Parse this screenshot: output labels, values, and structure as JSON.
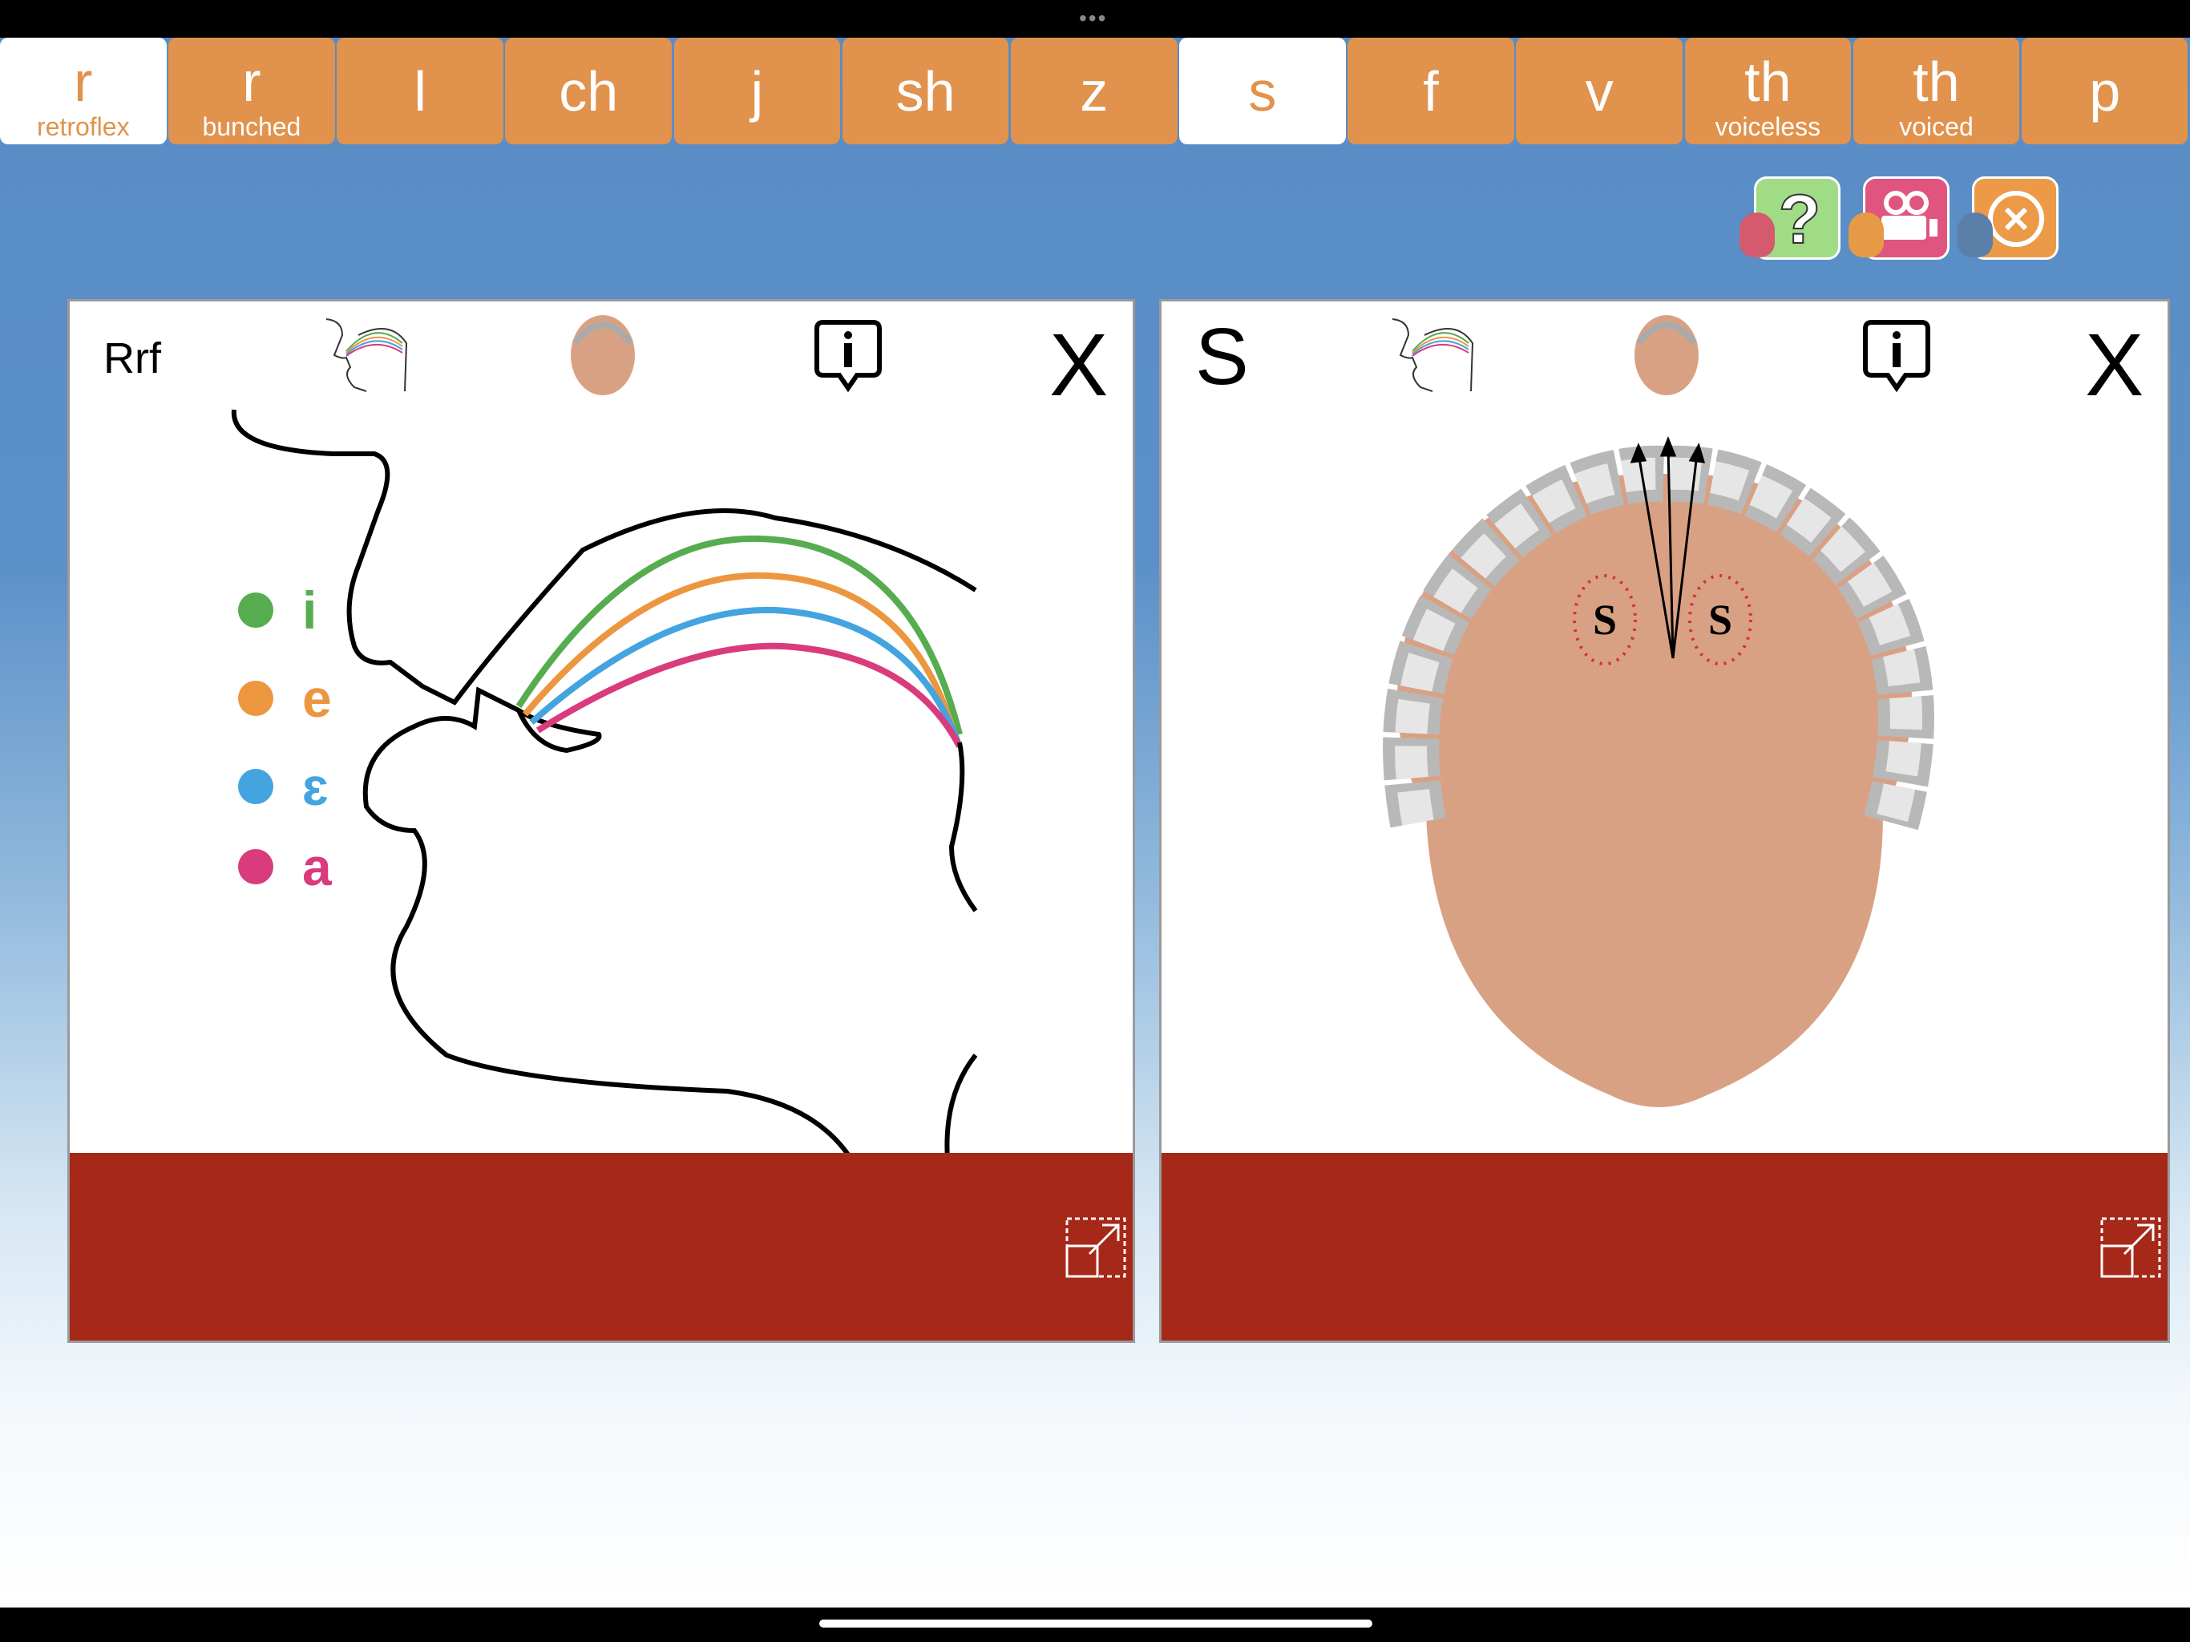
{
  "tabs": [
    {
      "label": "r",
      "sublabel": "retroflex",
      "active": true
    },
    {
      "label": "r",
      "sublabel": "bunched",
      "active": false
    },
    {
      "label": "l",
      "sublabel": "",
      "active": false
    },
    {
      "label": "ch",
      "sublabel": "",
      "active": false
    },
    {
      "label": "j",
      "sublabel": "",
      "active": false
    },
    {
      "label": "sh",
      "sublabel": "",
      "active": false
    },
    {
      "label": "z",
      "sublabel": "",
      "active": false
    },
    {
      "label": "s",
      "sublabel": "",
      "active": true
    },
    {
      "label": "f",
      "sublabel": "",
      "active": false
    },
    {
      "label": "v",
      "sublabel": "",
      "active": false
    },
    {
      "label": "th",
      "sublabel": "voiceless",
      "active": false
    },
    {
      "label": "th",
      "sublabel": "voiced",
      "active": false
    },
    {
      "label": "p",
      "sublabel": "",
      "active": false
    }
  ],
  "actions": [
    {
      "name": "help",
      "icon": "question-icon",
      "color": "#a0dc86"
    },
    {
      "name": "video",
      "icon": "video-camera-icon",
      "color": "#e0557f"
    },
    {
      "name": "close",
      "icon": "close-circle-icon",
      "color": "#ec9a48"
    }
  ],
  "left_panel": {
    "label": "Rrf",
    "close": "X",
    "legend": [
      {
        "label": "i",
        "color": "#57ac50"
      },
      {
        "label": "e",
        "color": "#ec9640"
      },
      {
        "label": "ɛ",
        "color": "#44a4e0"
      },
      {
        "label": "a",
        "color": "#d93b7d"
      }
    ]
  },
  "right_panel": {
    "label": "S",
    "close": "X",
    "palate_marks": [
      "S",
      "S"
    ]
  },
  "colors": {
    "tab": "#e1924c",
    "footer": "#a52819",
    "background": "#5a8cc4"
  }
}
